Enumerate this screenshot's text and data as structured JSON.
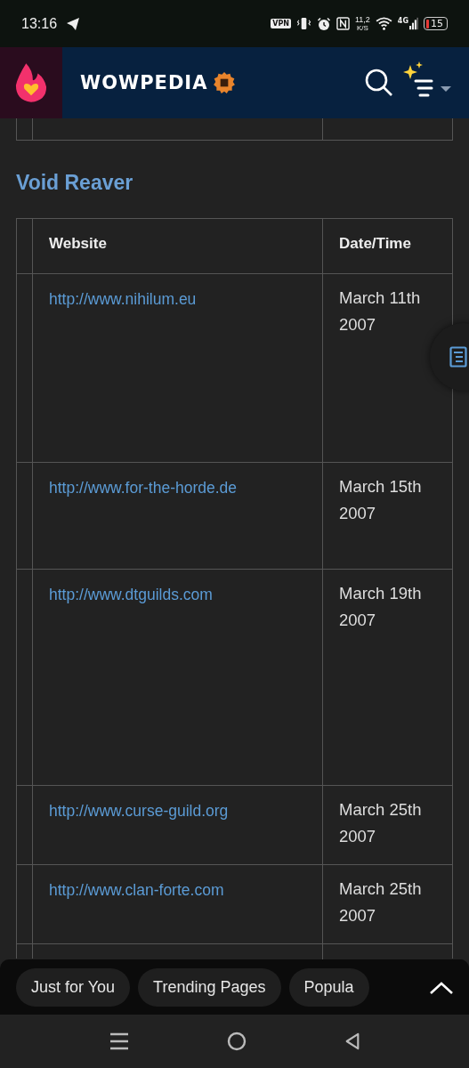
{
  "status_bar": {
    "time": "13:16",
    "vpn": "VPN",
    "speed": "11,2",
    "speed_unit": "K/S",
    "network": "4G",
    "battery": "15"
  },
  "header": {
    "site_name": "WOWPEDIA"
  },
  "section": {
    "title": "Void Reaver"
  },
  "table": {
    "columns": [
      "Website",
      "Date/Time"
    ],
    "rows": [
      {
        "website": "http://www.nihilum.eu",
        "date": "March 11th 2007"
      },
      {
        "website": "http://www.for-the-horde.de",
        "date": "March 15th 2007"
      },
      {
        "website": "http://www.dtguilds.com",
        "date": "March 19th 2007"
      },
      {
        "website": "http://www.curse-guild.org",
        "date": "March 25th 2007"
      },
      {
        "website": "http://www.clan-forte.com",
        "date": "March 25th 2007"
      }
    ]
  },
  "bottom_bar": {
    "chips": [
      {
        "label": "Just for You"
      },
      {
        "label": "Trending Pages"
      },
      {
        "label": "Popula"
      }
    ]
  }
}
